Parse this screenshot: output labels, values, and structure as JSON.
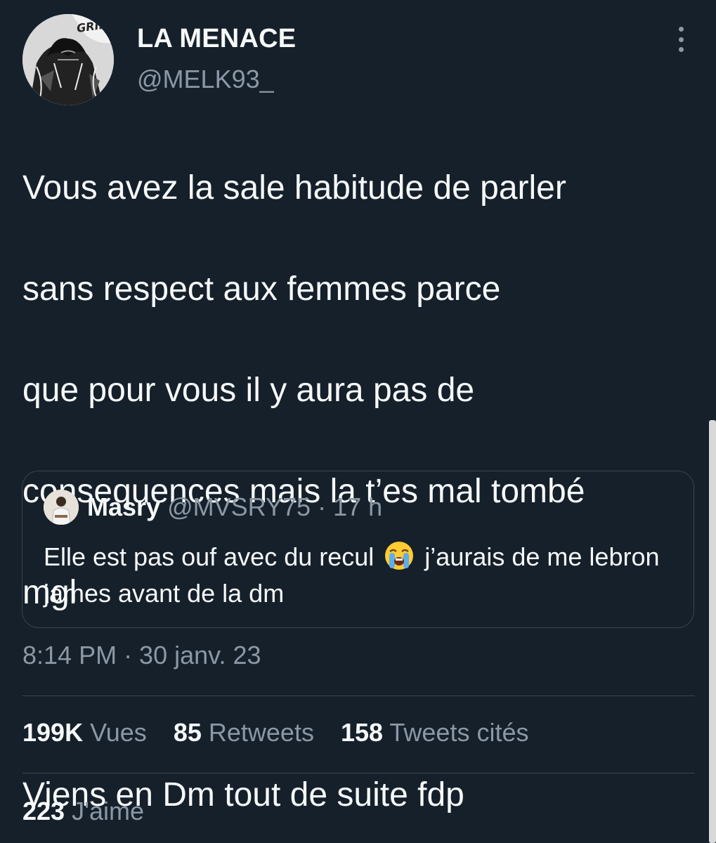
{
  "author": {
    "name": "LA MENACE",
    "handle": "@MELK93_",
    "avatar_icon": "manga-avatar",
    "avatar_text": "GRIFF"
  },
  "tweet": {
    "lines": [
      "Vous avez la sale habitude de parler",
      "sans respect aux femmes parce",
      "que pour vous il y aura pas de",
      "consequences mais la t’es mal tombé",
      "mgl",
      "",
      "Viens en Dm tout de suite fdp"
    ]
  },
  "quote": {
    "name": "Masry",
    "handle": "@MVSRY75",
    "time": "17 h",
    "text_before_emoji": "Elle est pas ouf avec du recul",
    "emoji": "loudly-crying-face",
    "text_after_emoji": "j’aurais de me lebron james avant de la dm"
  },
  "timestamp": "8:14 PM · 30 janv. 23",
  "stats": {
    "views_count": "199K",
    "views_label": "Vues",
    "retweets_count": "85",
    "retweets_label": "Retweets",
    "quotes_count": "158",
    "quotes_label": "Tweets cités",
    "likes_count": "223",
    "likes_label": "J'aime"
  },
  "colors": {
    "background": "#15202b",
    "text_primary": "#f7f9f9",
    "text_secondary": "#8b98a5",
    "border": "#38444d"
  }
}
